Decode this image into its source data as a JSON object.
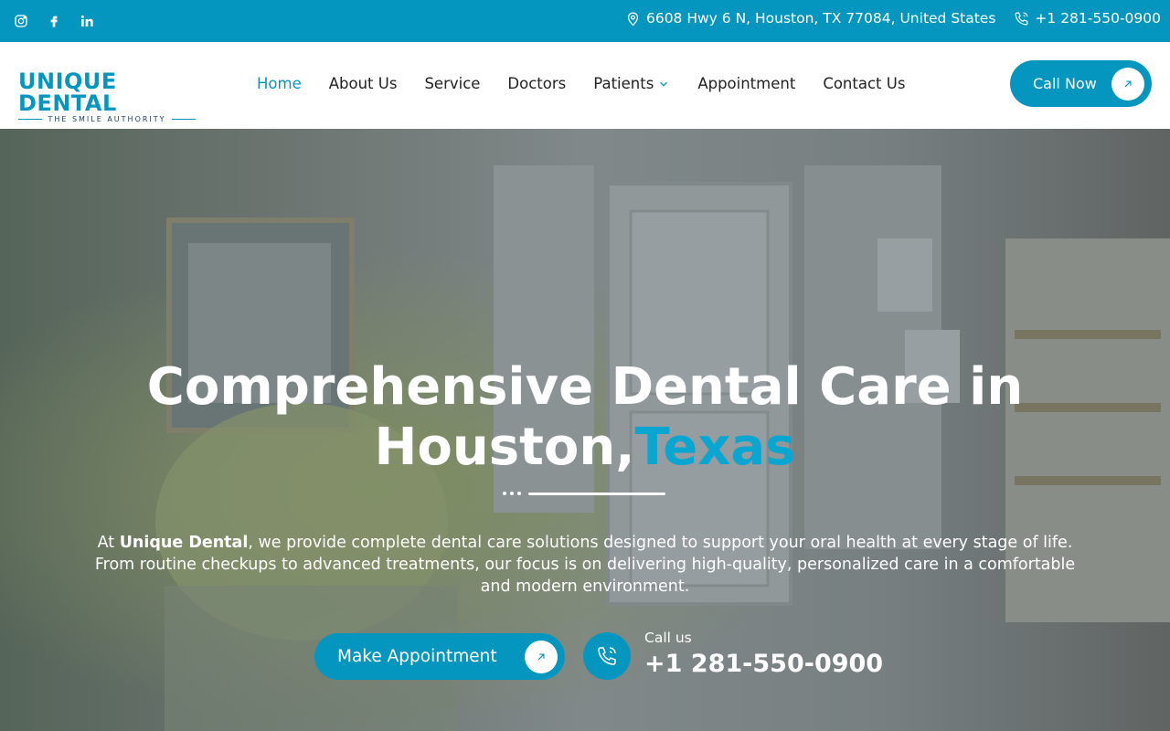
{
  "topbar": {
    "social_icons": [
      "instagram-icon",
      "facebook-icon",
      "linkedin-icon"
    ],
    "address": "6608 Hwy 6 N, Houston, TX 77084, United States",
    "phone": "+1 281-550-0900"
  },
  "logo": {
    "name": "UNIQUE DENTAL",
    "tagline": "THE SMILE AUTHORITY"
  },
  "nav": {
    "items": [
      {
        "label": "Home",
        "active": true
      },
      {
        "label": "About Us"
      },
      {
        "label": "Service"
      },
      {
        "label": "Doctors"
      },
      {
        "label": "Patients",
        "has_dropdown": true
      },
      {
        "label": "Appointment"
      },
      {
        "label": "Contact Us"
      }
    ]
  },
  "header": {
    "cta_label": "Call Now"
  },
  "hero": {
    "title_line1": "Comprehensive Dental Care in",
    "title_line2_main": "Houston,",
    "title_line2_accent": "Texas",
    "text_prefix": "At ",
    "text_brand": "Unique Dental",
    "text_rest": ", we provide complete dental care solutions designed to support your oral health at every stage of life. From routine checkups to advanced treatments, our focus is on delivering high-quality, personalized care in a comfortable and modern environment.",
    "primary_button": "Make Appointment",
    "call_label": "Call us",
    "call_number": "+1 281-550-0900"
  },
  "colors": {
    "brand": "#0596c0",
    "accent": "#0aa6d2",
    "nav_text": "#222222"
  }
}
